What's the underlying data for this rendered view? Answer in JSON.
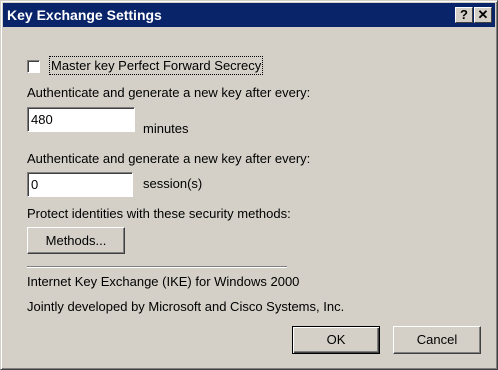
{
  "dialog": {
    "title": "Key Exchange Settings",
    "help_glyph": "?",
    "close_glyph": "✕"
  },
  "pfs": {
    "label": "Master key Perfect Forward Secrecy",
    "checked": false
  },
  "minutes_section": {
    "label": "Authenticate and generate a new key after every:",
    "value": "480",
    "unit": "minutes"
  },
  "sessions_section": {
    "label": "Authenticate and generate a new key after every:",
    "value": "0",
    "unit": "session(s)"
  },
  "protect": {
    "label": "Protect identities with these security methods:",
    "methods_button": "Methods..."
  },
  "info": {
    "line1": "Internet Key Exchange (IKE) for Windows 2000",
    "line2": "Jointly developed by Microsoft and Cisco Systems, Inc."
  },
  "buttons": {
    "ok": "OK",
    "cancel": "Cancel"
  }
}
